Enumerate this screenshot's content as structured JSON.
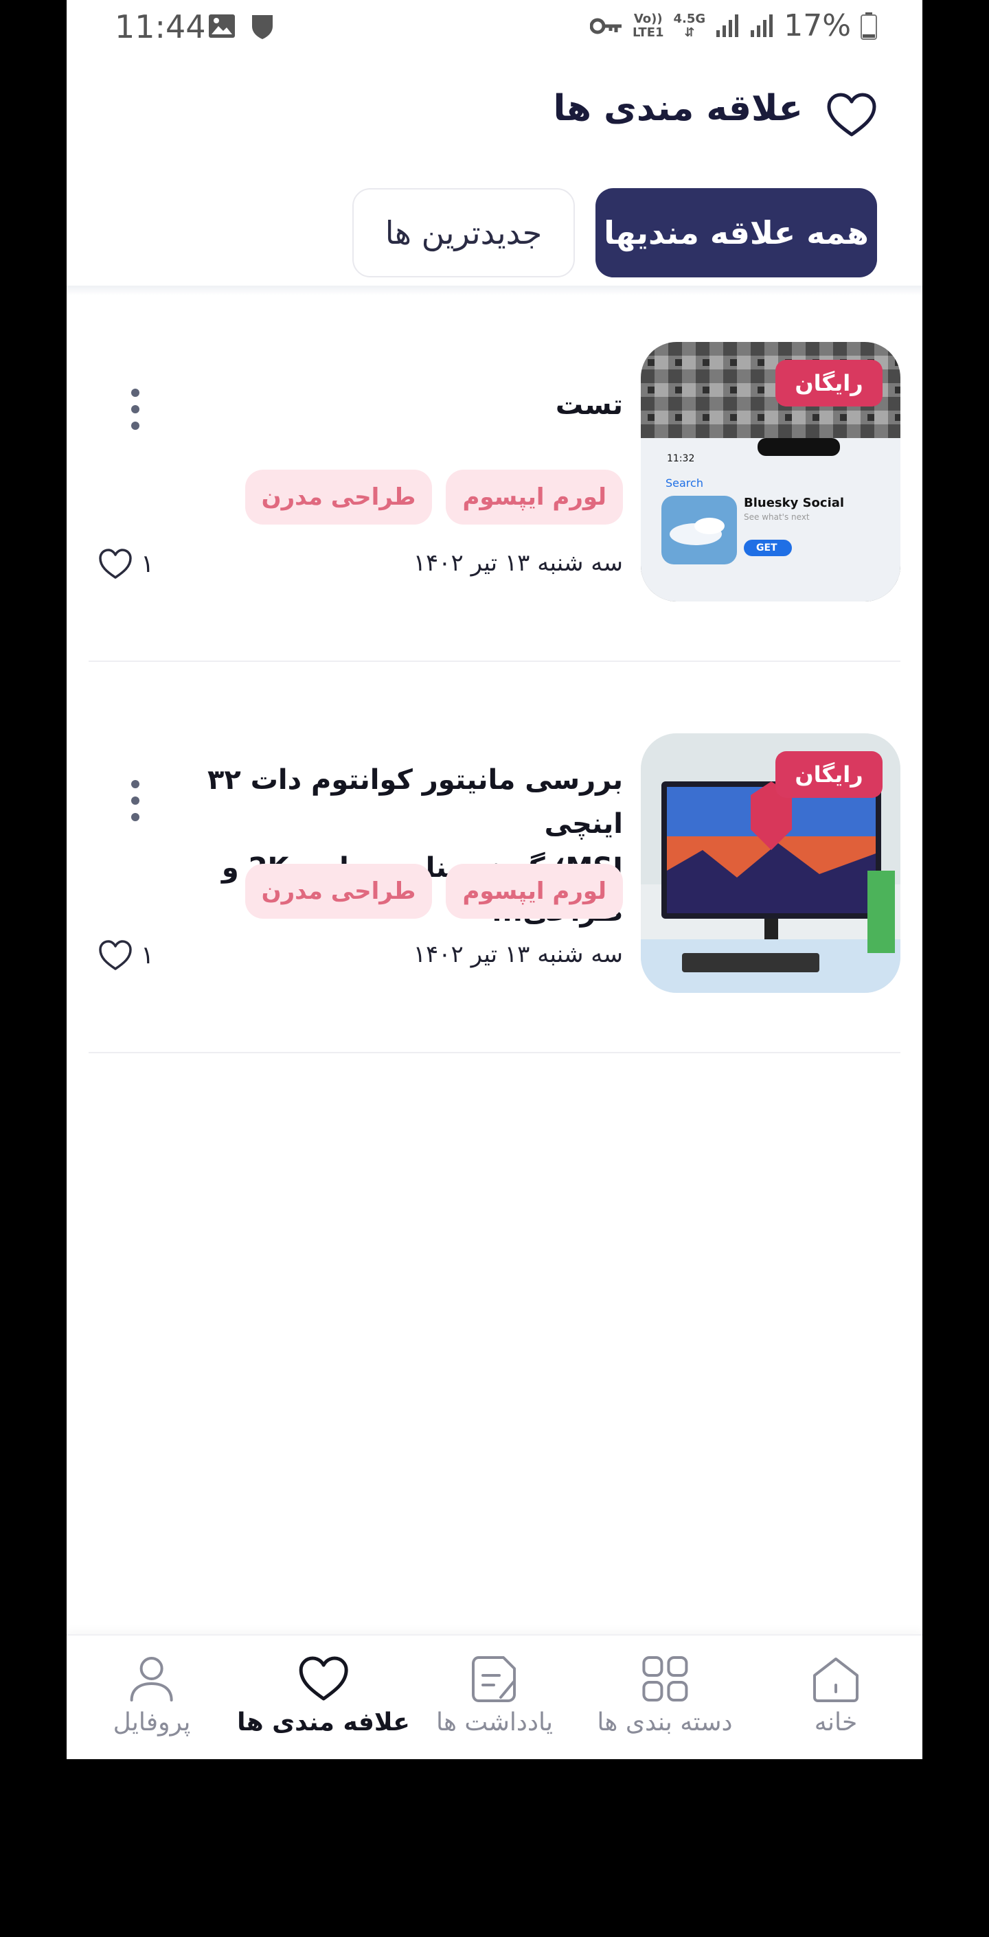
{
  "status_bar": {
    "time": "11:44",
    "network_top": "Vo))",
    "network_bottom": "LTE1",
    "network_speed": "4.5G",
    "battery": "17%"
  },
  "header": {
    "title": "علاقه مندی ها",
    "icon": "heart-icon"
  },
  "tabs": [
    {
      "label": "همه علاقه مندیها",
      "active": true
    },
    {
      "label": "جدیدترین ها",
      "active": false
    }
  ],
  "cards": [
    {
      "badge": "رایگان",
      "title": "تست",
      "tags": [
        "لورم ایپسوم",
        "طراحی مدرن"
      ],
      "date": "سه شنبه ۱۳ تیر ۱۴۰۲",
      "likes": "۱",
      "thumb_text": {
        "search": "Search",
        "app_name": "Bluesky Social",
        "app_sub": "See what's next",
        "get": "GET",
        "clock": "11:32"
      }
    },
    {
      "badge": "رایگان",
      "title_line1": "بررسی مانیتور کوانتوم دات ۳۲ اینچی",
      "title_line2": "MSI؛ گزینه مناسب بازی 2K و طراحی...",
      "tags": [
        "لورم ایپسوم",
        "طراحی مدرن"
      ],
      "date": "سه شنبه ۱۳ تیر ۱۴۰۲",
      "likes": "۱"
    }
  ],
  "bottom_nav": [
    {
      "label": "خانه",
      "icon": "home-icon",
      "active": false
    },
    {
      "label": "دسته بندی ها",
      "icon": "grid-icon",
      "active": false
    },
    {
      "label": "یادداشت ها",
      "icon": "note-icon",
      "active": false
    },
    {
      "label": "علافه مندی ها",
      "icon": "heart-icon",
      "active": true
    },
    {
      "label": "پروفایل",
      "icon": "user-icon",
      "active": false
    }
  ],
  "colors": {
    "primary": "#2e3164",
    "badge": "#d9395f",
    "tag_bg": "#fde5ea",
    "tag_text": "#e0697f"
  }
}
